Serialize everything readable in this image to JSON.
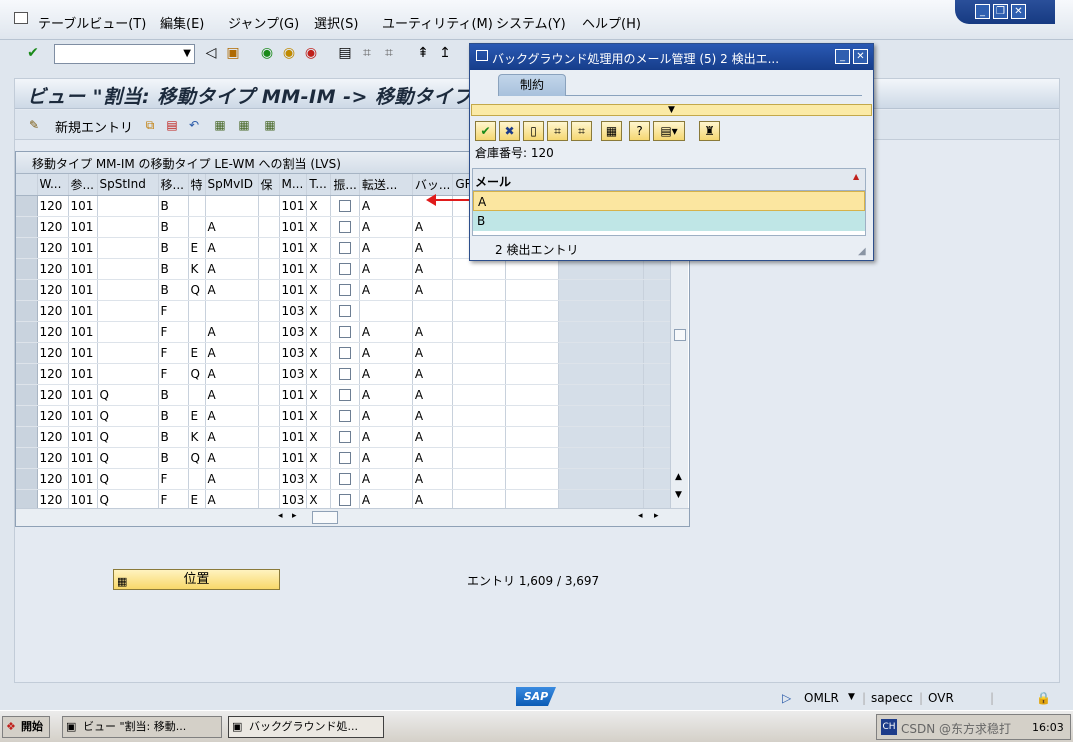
{
  "menu": [
    "テーブルビュー(T)",
    "編集(E)",
    "ジャンプ(G)",
    "選択(S)",
    "ユーティリティ(M)",
    "システム(Y)",
    "ヘルプ(H)"
  ],
  "window_controls": [
    "_",
    "❐",
    "✕"
  ],
  "main": {
    "title": "ビュー \"割当: 移動タイプ MM-IM -> 移動タイプ",
    "new_entries": "新規エントリ",
    "table_title": "移動タイプ MM-IM の移動タイプ LE-WM への割当 (LVS)",
    "columns": [
      "W...",
      "参...",
      "SpStInd",
      "移...",
      "特",
      "SpMvID",
      "保",
      "M...",
      "T...",
      "振...",
      "転送...",
      "バッ...",
      "GR",
      "",
      "",
      ""
    ],
    "rows": [
      [
        "120",
        "101",
        "",
        "B",
        "",
        "",
        "",
        "101",
        "X",
        "",
        "A",
        "",
        "",
        ""
      ],
      [
        "120",
        "101",
        "",
        "B",
        "",
        "A",
        "",
        "101",
        "X",
        "",
        "A",
        "A",
        "",
        ""
      ],
      [
        "120",
        "101",
        "",
        "B",
        "E",
        "A",
        "",
        "101",
        "X",
        "",
        "A",
        "A",
        "",
        ""
      ],
      [
        "120",
        "101",
        "",
        "B",
        "K",
        "A",
        "",
        "101",
        "X",
        "",
        "A",
        "A",
        "",
        ""
      ],
      [
        "120",
        "101",
        "",
        "B",
        "Q",
        "A",
        "",
        "101",
        "X",
        "",
        "A",
        "A",
        "",
        ""
      ],
      [
        "120",
        "101",
        "",
        "F",
        "",
        "",
        "",
        "103",
        "X",
        "",
        "",
        "",
        "",
        ""
      ],
      [
        "120",
        "101",
        "",
        "F",
        "",
        "A",
        "",
        "103",
        "X",
        "",
        "A",
        "A",
        "",
        ""
      ],
      [
        "120",
        "101",
        "",
        "F",
        "E",
        "A",
        "",
        "103",
        "X",
        "",
        "A",
        "A",
        "",
        ""
      ],
      [
        "120",
        "101",
        "",
        "F",
        "Q",
        "A",
        "",
        "103",
        "X",
        "",
        "A",
        "A",
        "",
        ""
      ],
      [
        "120",
        "101",
        "Q",
        "B",
        "",
        "A",
        "",
        "101",
        "X",
        "",
        "A",
        "A",
        "",
        ""
      ],
      [
        "120",
        "101",
        "Q",
        "B",
        "E",
        "A",
        "",
        "101",
        "X",
        "",
        "A",
        "A",
        "",
        ""
      ],
      [
        "120",
        "101",
        "Q",
        "B",
        "K",
        "A",
        "",
        "101",
        "X",
        "",
        "A",
        "A",
        "",
        ""
      ],
      [
        "120",
        "101",
        "Q",
        "B",
        "Q",
        "A",
        "",
        "101",
        "X",
        "",
        "A",
        "A",
        "",
        ""
      ],
      [
        "120",
        "101",
        "Q",
        "F",
        "",
        "A",
        "",
        "103",
        "X",
        "",
        "A",
        "A",
        "",
        ""
      ],
      [
        "120",
        "101",
        "Q",
        "F",
        "E",
        "A",
        "",
        "103",
        "X",
        "",
        "A",
        "A",
        "",
        ""
      ]
    ],
    "position_button": "位置",
    "entries_label": "エントリ 1,609 / 3,697"
  },
  "popup": {
    "title": "バックグラウンド処理用のメール管理 (5)   2 検出エ...",
    "tab": "制約",
    "warehouse_label": "倉庫番号: 120",
    "list_header": "メール",
    "items": [
      "A",
      "B"
    ],
    "footer": "2 検出エントリ"
  },
  "status": {
    "sap": "SAP",
    "system": "OMLR",
    "server": "sapecc",
    "mode": "OVR"
  },
  "taskbar": {
    "start": "開始",
    "tasks": [
      "ビュー \"割当: 移動...",
      "バックグラウンド処..."
    ],
    "tray_text": "CSDN @东方求稳打",
    "clock": "16:03"
  },
  "colors": {
    "highlight_row": "#fbe6a0",
    "selected_row": "#bfe6e6",
    "arrow": "#e01b1b"
  }
}
